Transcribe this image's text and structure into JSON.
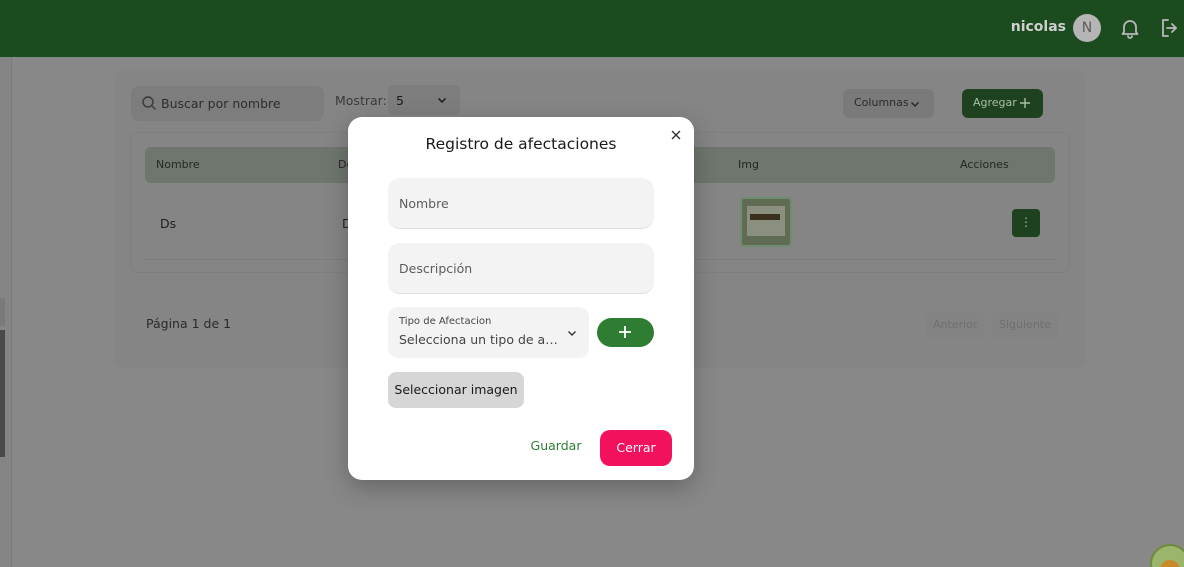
{
  "header": {
    "user_name": "nicolas",
    "avatar_initial": "N",
    "icons": [
      "bell-icon",
      "logout-icon"
    ]
  },
  "toolbar": {
    "search_placeholder": "Buscar por nombre",
    "show_label": "Mostrar:",
    "show_value": "5",
    "columns_label": "Columnas",
    "add_label": "Agregar"
  },
  "table": {
    "columns": [
      "Nombre",
      "De",
      "Img",
      "Acciones"
    ],
    "rows": [
      {
        "nombre": "Ds",
        "descripcion": "D",
        "menu": "⋮"
      }
    ]
  },
  "pagination": {
    "page_text": "Página 1 de 1",
    "prev_label": "Anterior",
    "next_label": "Siguiente"
  },
  "modal": {
    "title": "Registro de afectaciones",
    "name_placeholder": "Nombre",
    "description_placeholder": "Descripción",
    "type_label": "Tipo de Afectacion",
    "type_value": "Selecciona un tipo de afectación",
    "select_image_label": "Seleccionar imagen",
    "save_label": "Guardar",
    "close_label": "Cerrar"
  },
  "colors": {
    "header_bg": "#1c4b1f",
    "primary_green": "#2e7d32",
    "close_pink": "#f1115d",
    "overlay": "#888888"
  }
}
